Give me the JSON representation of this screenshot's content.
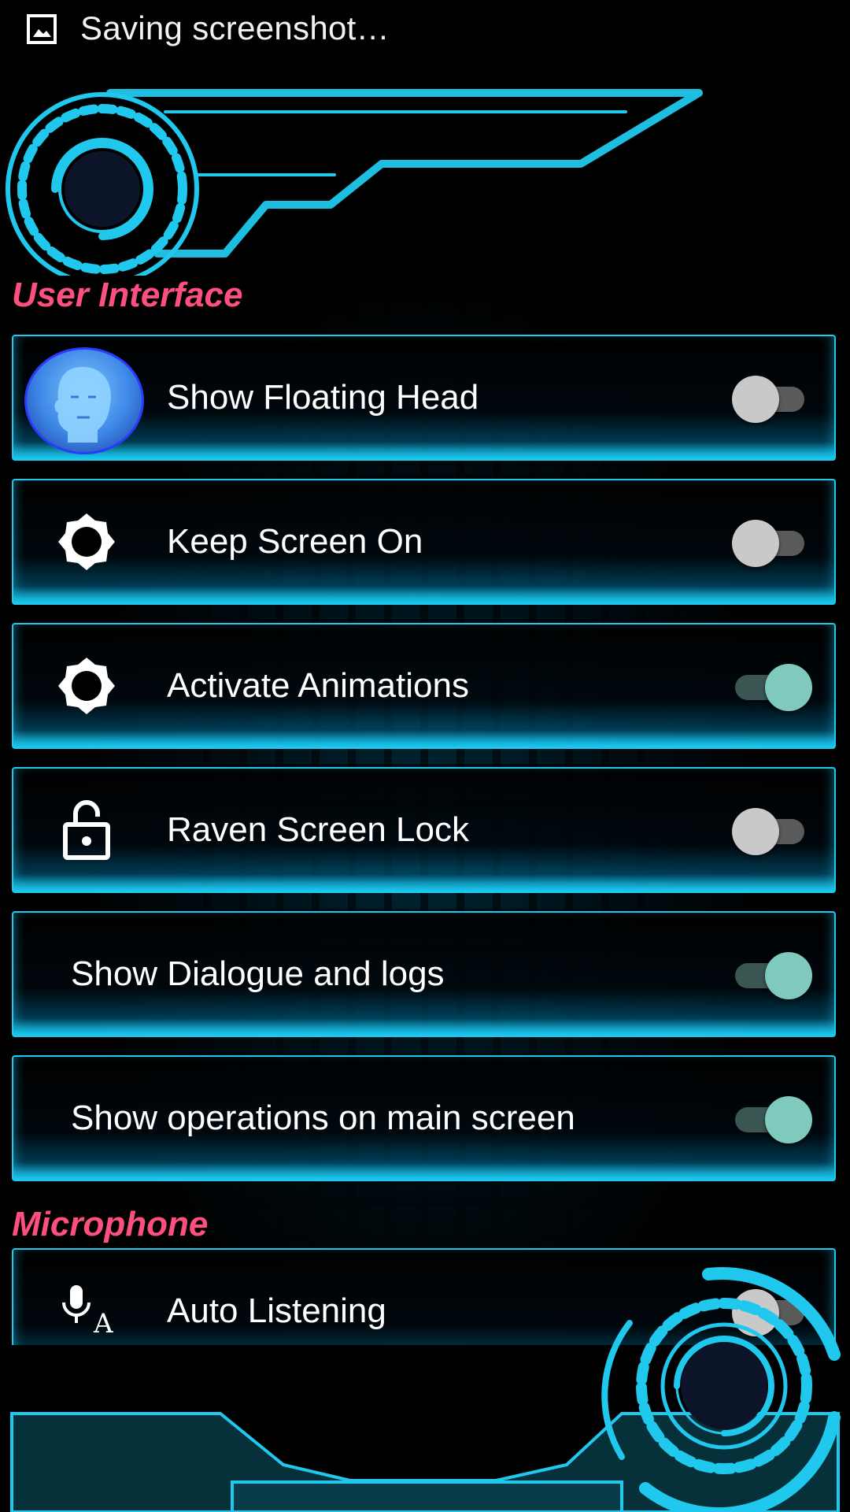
{
  "status_bar": {
    "icon": "image-icon",
    "text": "Saving screenshot…"
  },
  "sections": {
    "user_interface": "User Interface",
    "microphone": "Microphone"
  },
  "settings": [
    {
      "label": "Show Floating Head",
      "icon": "floating-head-avatar",
      "enabled": false
    },
    {
      "label": "Keep Screen On",
      "icon": "brightness-icon",
      "enabled": false
    },
    {
      "label": "Activate Animations",
      "icon": "brightness-icon",
      "enabled": true
    },
    {
      "label": "Raven Screen Lock",
      "icon": "lock-open-icon",
      "enabled": false
    },
    {
      "label": "Show Dialogue and logs",
      "icon": "",
      "enabled": true
    },
    {
      "label": "Show operations on main screen",
      "icon": "",
      "enabled": true
    },
    {
      "label": "Auto Listening",
      "icon": "mic-language-icon",
      "enabled": false
    }
  ],
  "colors": {
    "accent": "#1fc8ec",
    "section_title": "#ff4f7e",
    "toggle_on": "#7fcabd",
    "toggle_off": "#c9c9c9"
  }
}
